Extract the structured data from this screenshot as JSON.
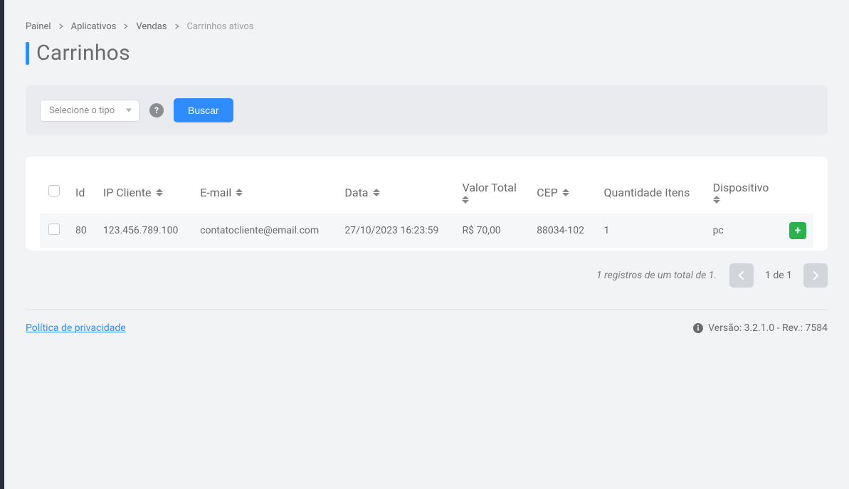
{
  "breadcrumb": {
    "items": [
      "Painel",
      "Aplicativos",
      "Vendas"
    ],
    "current": "Carrinhos ativos"
  },
  "page_title": "Carrinhos",
  "filter": {
    "select_placeholder": "Selecione o tipo",
    "help_symbol": "?",
    "search_label": "Buscar"
  },
  "table": {
    "headers": {
      "id": "Id",
      "ip": "IP Cliente",
      "email": "E-mail",
      "date": "Data",
      "total": "Valor Total",
      "cep": "CEP",
      "qty": "Quantidade Itens",
      "device": "Dispositivo"
    },
    "rows": [
      {
        "id": "80",
        "ip": "123.456.789.100",
        "email": "contatocliente@email.com",
        "date": "27/10/2023 16:23:59",
        "total": "R$ 70,00",
        "cep": "88034-102",
        "qty": "1",
        "device": "pc",
        "expand_symbol": "+"
      }
    ]
  },
  "pagination": {
    "info": "1 registros de um total de 1.",
    "page_text": "1 de 1"
  },
  "footer": {
    "privacy": "Política de privacidade",
    "version": "Versão: 3.2.1.0 - Rev.: 7584"
  }
}
